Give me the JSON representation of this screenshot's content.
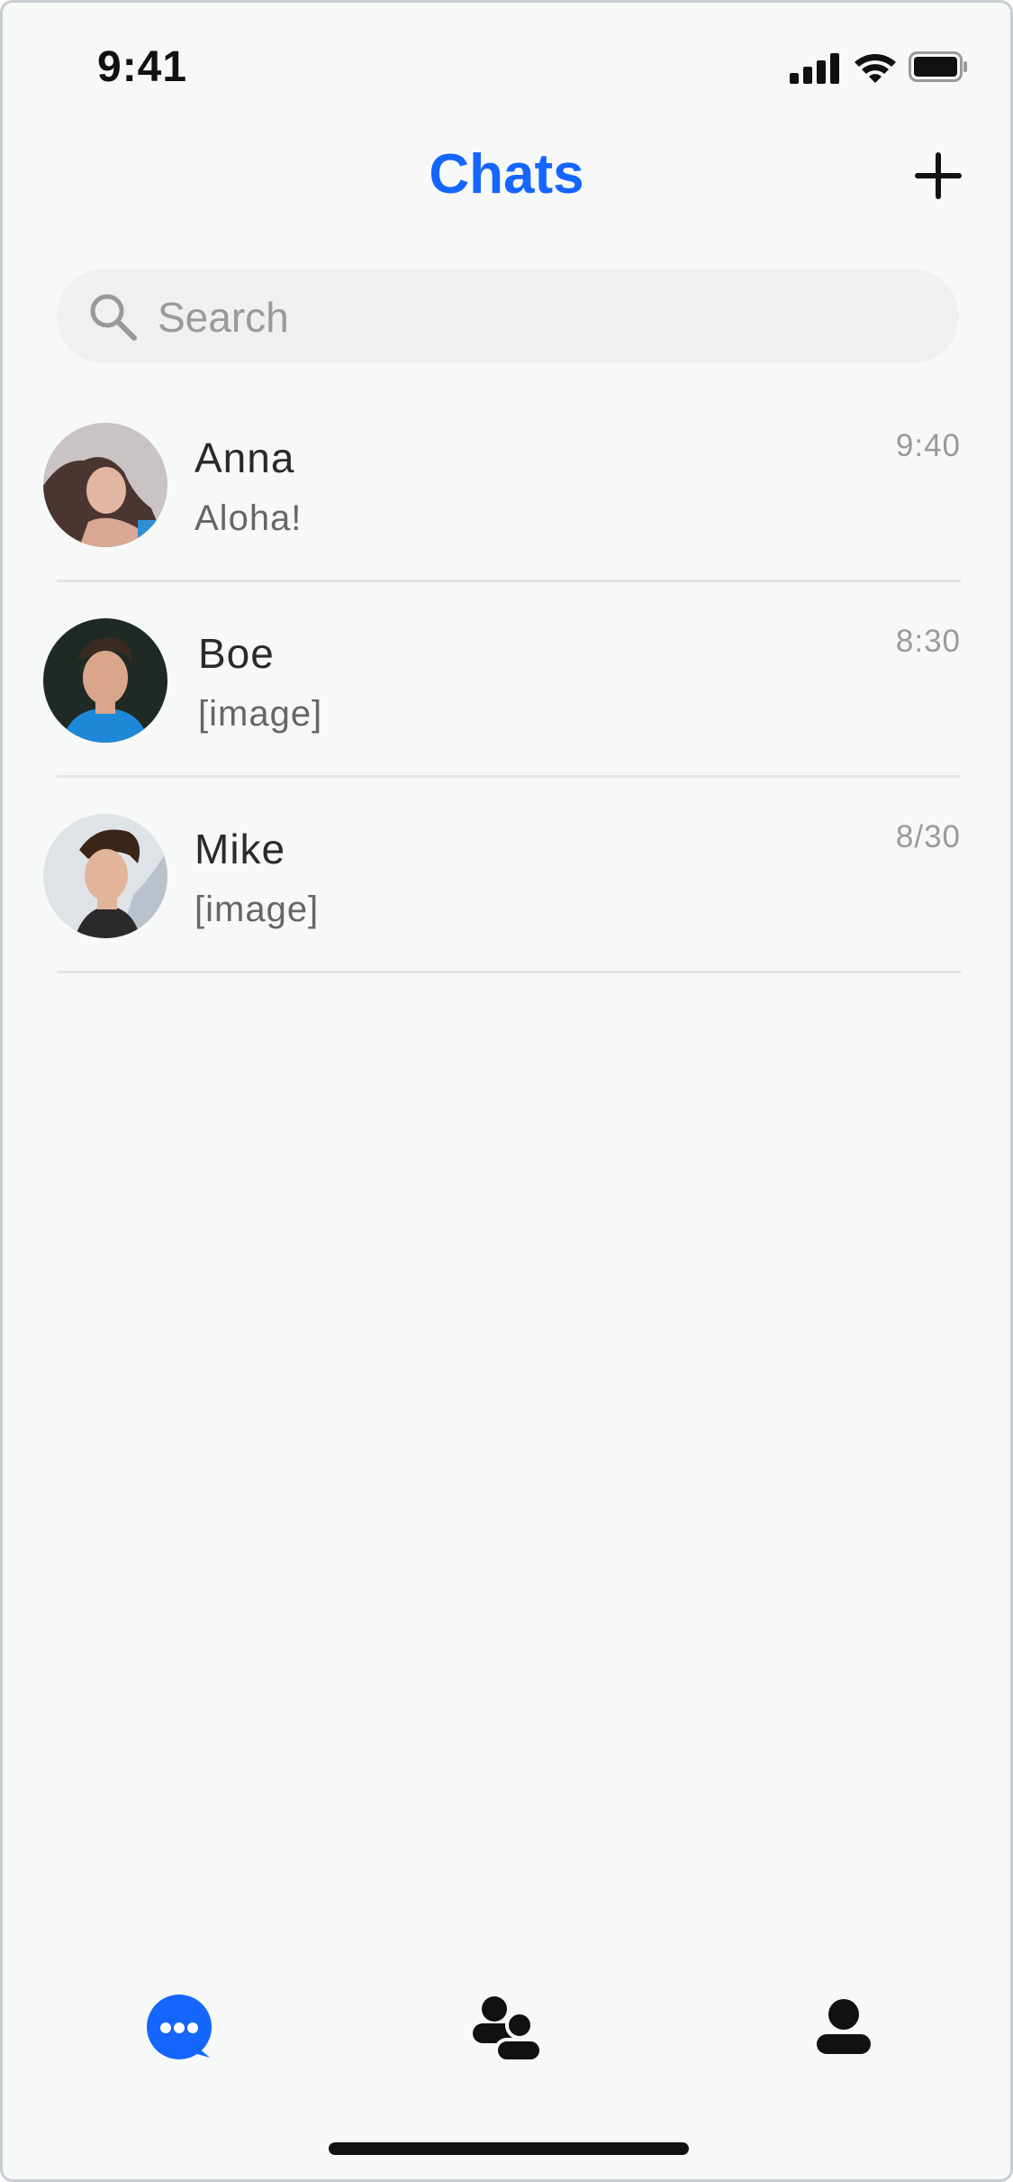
{
  "status_bar": {
    "time": "9:41",
    "icons": [
      "signal-icon",
      "wifi-icon",
      "battery-icon"
    ]
  },
  "header": {
    "title": "Chats",
    "add_icon": "plus-icon"
  },
  "search": {
    "placeholder": "Search",
    "value": ""
  },
  "chats": [
    {
      "name": "Anna",
      "message": "Aloha!",
      "time": "9:40"
    },
    {
      "name": "Boe",
      "message": "[image]",
      "time": "8:30"
    },
    {
      "name": "Mike",
      "message": "[image]",
      "time": "8/30"
    }
  ],
  "tabs": [
    {
      "id": "chats",
      "icon": "chat-bubble-icon",
      "active": true
    },
    {
      "id": "contacts",
      "icon": "people-icon",
      "active": false
    },
    {
      "id": "profile",
      "icon": "person-icon",
      "active": false
    }
  ],
  "colors": {
    "accent": "#1565ff",
    "background": "#f7f9f9",
    "search_bg": "#eff0f0",
    "divider": "#e2e4e6"
  }
}
